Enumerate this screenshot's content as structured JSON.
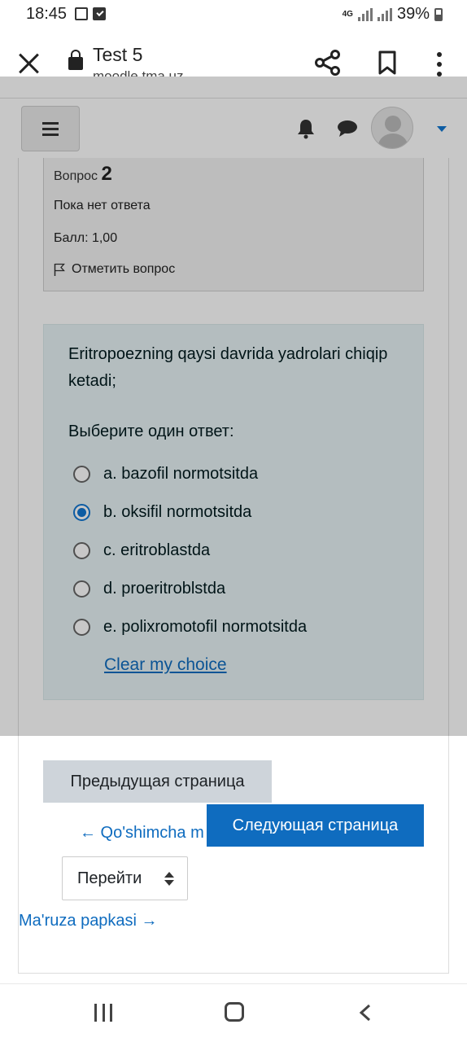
{
  "status_bar": {
    "time": "18:45",
    "network": "4G",
    "battery": "39%"
  },
  "browser": {
    "title": "Test 5",
    "url": "moodle.tma.uz"
  },
  "question_info": {
    "label": "Вопрос",
    "number": "2",
    "state": "Пока нет ответа",
    "mark": "Балл: 1,00",
    "flag_label": "Отметить вопрос"
  },
  "question": {
    "text": "Eritropoezning qaysi davrida yadrolari chiqip ketadi;",
    "prompt": "Выберите один ответ:",
    "answers": [
      {
        "label": "a. bazofil normotsitda",
        "selected": false
      },
      {
        "label": "b. oksifil normotsitda",
        "selected": true
      },
      {
        "label": "c. eritroblastda",
        "selected": false
      },
      {
        "label": "d. proeritroblstda",
        "selected": false
      },
      {
        "label": "e. polixromotofil normotsitda",
        "selected": false
      }
    ],
    "clear_label": "Clear my choice"
  },
  "navigation": {
    "prev_button": "Предыдущая страница",
    "next_button": "Следующая страница",
    "prev_link": "← Qo'shimcha m",
    "jump_label": "Перейти",
    "next_link": "Ma'ruza papkasi →"
  },
  "colors": {
    "accent": "#0f6cbf",
    "question_bg": "#e7f3f5",
    "info_bg": "#f3f3f3",
    "secondary_button": "#ced4da"
  }
}
